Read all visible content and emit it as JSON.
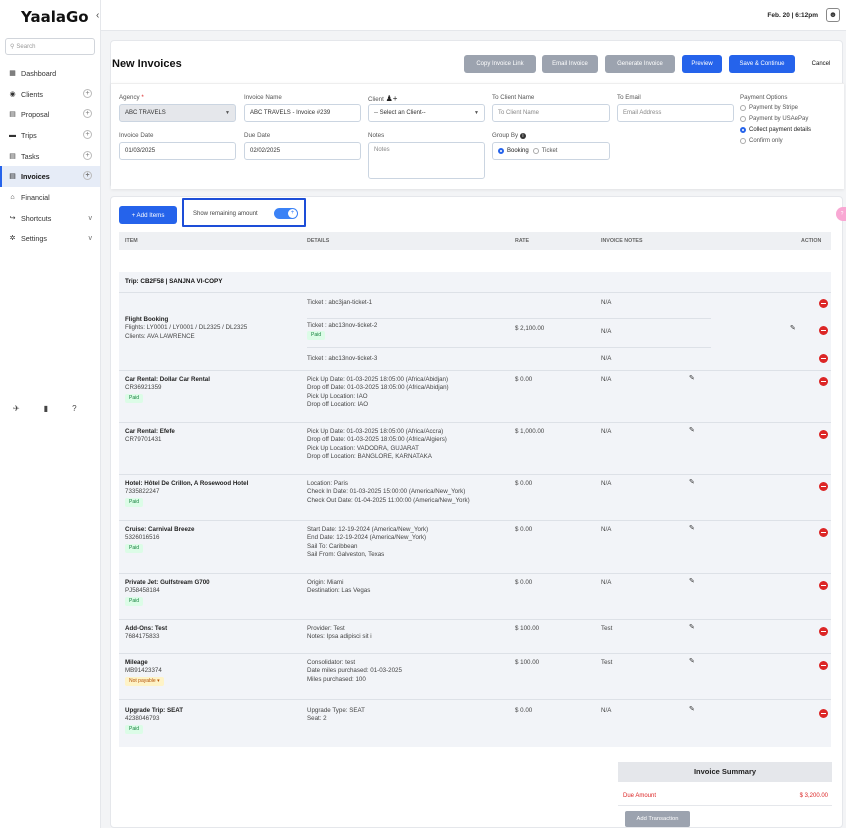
{
  "app": {
    "logo": "YaalaGo",
    "datetime": "Feb. 20 | 6:12pm"
  },
  "sidebar": {
    "search_placeholder": "Search",
    "items": [
      {
        "label": "Dashboard",
        "icon": "dashboard-icon",
        "suffix": ""
      },
      {
        "label": "Clients",
        "icon": "clients-icon",
        "suffix": "+"
      },
      {
        "label": "Proposal",
        "icon": "proposal-icon",
        "suffix": "+"
      },
      {
        "label": "Trips",
        "icon": "trips-icon",
        "suffix": "+"
      },
      {
        "label": "Tasks",
        "icon": "tasks-icon",
        "suffix": "+"
      },
      {
        "label": "Invoices",
        "icon": "invoices-icon",
        "suffix": "+",
        "active": true
      },
      {
        "label": "Financial",
        "icon": "financial-icon",
        "suffix": ""
      },
      {
        "label": "Shortcuts",
        "icon": "shortcuts-icon",
        "suffix": "v"
      },
      {
        "label": "Settings",
        "icon": "settings-icon",
        "suffix": "v"
      }
    ]
  },
  "header": {
    "title": "New Invoices",
    "buttons": {
      "copy_link": "Copy Invoice Link",
      "email": "Email Invoice",
      "generate": "Generate Invoice",
      "preview": "Preview",
      "save": "Save & Continue",
      "cancel": "Cancel"
    }
  },
  "form": {
    "agency_label": "Agency",
    "agency_value": "ABC TRAVELS",
    "invoice_name_label": "Invoice Name",
    "invoice_name_value": "ABC TRAVELS - Invoice #239",
    "client_label": "Client",
    "client_value": "-- Select an Client--",
    "to_client_label": "To Client Name",
    "to_client_placeholder": "To Client Name",
    "to_email_label": "To Email",
    "to_email_placeholder": "Email Address",
    "payment_label": "Payment Options",
    "payment_options": [
      "Payment by Stripe",
      "Payment by USAePay",
      "Collect payment details",
      "Confirm only"
    ],
    "invoice_date_label": "Invoice Date",
    "invoice_date_value": "01/03/2025",
    "due_date_label": "Due Date",
    "due_date_value": "02/02/2025",
    "notes_label": "Notes",
    "notes_placeholder": "Notes",
    "group_by_label": "Group By",
    "group_by_options": [
      "Booking",
      "Ticket"
    ]
  },
  "items": {
    "add_label": "+ Add Items",
    "toggle_label": "Show remaining amount",
    "columns": {
      "item": "ITEM",
      "details": "DETAILS",
      "rate": "RATE",
      "notes": "INVOICE NOTES",
      "action": "ACTION"
    },
    "trip_title": "Trip: CB2F58 | SANJNA VI-COPY",
    "flight": {
      "title": "Flight Booking",
      "flights": "Flights: LY0001 / LY0001 / DL2325 / DL2325",
      "clients": "Clients: AVA LAWRENCE",
      "rate": "$ 2,100.00",
      "tickets": [
        {
          "label": "Ticket : abc3jan-ticket-1",
          "badge": "",
          "note": "N/A"
        },
        {
          "label": "Ticket : abc13nov-ticket-2",
          "badge": "Paid",
          "note": "N/A"
        },
        {
          "label": "Ticket : abc13nov-ticket-3",
          "badge": "",
          "note": "N/A"
        }
      ]
    },
    "rows": [
      {
        "title": "Car Rental: Dollar Car Rental",
        "code": "CR36921359",
        "badge": "Paid",
        "details": [
          "Pick Up Date: 01-03-2025 18:05:00 (Africa/Abidjan)",
          "Drop off Date: 01-03-2025 18:05:00 (Africa/Abidjan)",
          "Pick Up Location: IAO",
          "Drop off Location: IAO"
        ],
        "rate": "$ 0.00",
        "note": "N/A"
      },
      {
        "title": "Car Rental: Efefe",
        "code": "CR79701431",
        "badge": "",
        "details": [
          "Pick Up Date: 01-03-2025 18:05:00 (Africa/Accra)",
          "Drop off Date: 01-03-2025 18:05:00 (Africa/Algiers)",
          "Pick Up Location: VADODRA, GUJARAT",
          "Drop off Location: BANGLORE, KARNATAKA"
        ],
        "rate": "$ 1,000.00",
        "note": "N/A"
      },
      {
        "title": "Hotel: Hôtel De Crillon, A Rosewood Hotel",
        "code": "7335822247",
        "badge": "Paid",
        "details": [
          "Location: Paris",
          "Check In Date: 01-03-2025 15:00:00 (America/New_York)",
          "Check Out Date: 01-04-2025 11:00:00 (America/New_York)"
        ],
        "rate": "$ 0.00",
        "note": "N/A"
      },
      {
        "title": "Cruise: Carnival Breeze",
        "code": "5326016516",
        "badge": "Paid",
        "details": [
          "Start Date: 12-19-2024 (America/New_York)",
          "End Date: 12-19-2024 (America/New_York)",
          "Sail To: Caribbean",
          "Sail From: Galveston, Texas"
        ],
        "rate": "$ 0.00",
        "note": "N/A"
      },
      {
        "title": "Private Jet: Gulfstream G700",
        "code": "PJ58458184",
        "badge": "Paid",
        "details": [
          "Origin: Miami",
          "Destination: Las Vegas"
        ],
        "rate": "$ 0.00",
        "note": "N/A"
      },
      {
        "title": "Add-Ons: Test",
        "code": "7684175833",
        "badge": "",
        "details": [
          "Provider: Test",
          "Notes: Ipsa adipisci sit i"
        ],
        "rate": "$ 100.00",
        "note": "Test"
      },
      {
        "title": "Mileage",
        "code": "MB91423374",
        "badge": "Not payable",
        "details": [
          "Consolidator: test",
          "Date miles purchased: 01-03-2025",
          "Miles purchased: 100"
        ],
        "rate": "$ 100.00",
        "note": "Test"
      },
      {
        "title": "Upgrade Trip: SEAT",
        "code": "4238046793",
        "badge": "Paid",
        "details": [
          "Upgrade Type: SEAT",
          "Seat: 2"
        ],
        "rate": "$ 0.00",
        "note": "N/A"
      }
    ]
  },
  "summary": {
    "title": "Invoice Summary",
    "due_label": "Due Amount",
    "due_value": "$ 3,200.00",
    "add_transaction": "Add Transaction"
  },
  "colors": {
    "accent": "#2563eb",
    "danger": "#dc2626",
    "paid_bg": "#dcfce7"
  }
}
